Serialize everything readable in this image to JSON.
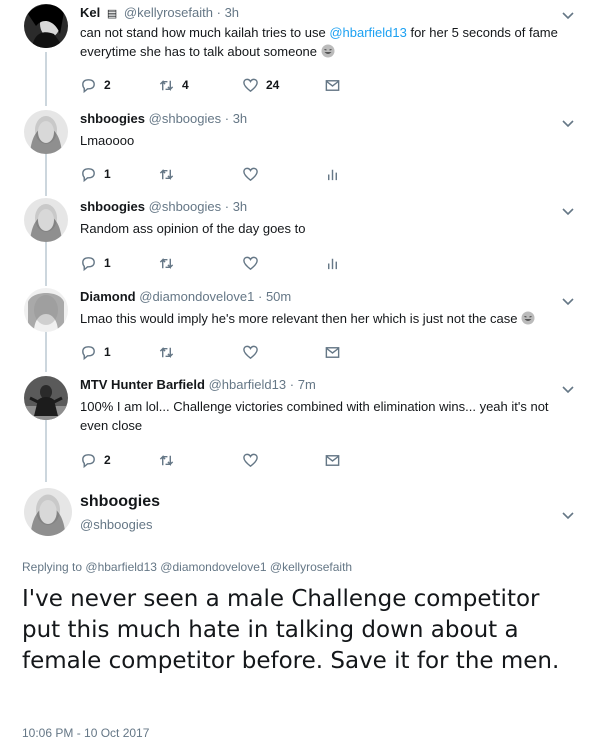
{
  "colors": {
    "link": "#1da1f2",
    "muted": "#657786",
    "thread": "#ccd6dd"
  },
  "tweets": [
    {
      "name": "Kel",
      "lock_icon": "lock-icon",
      "handle": "@kellyrosefaith",
      "sep": "·",
      "time": "3h",
      "text_before": "can not stand how much kailah tries to use ",
      "mention": "@hbarfield13",
      "text_after": " for her 5 seconds of fame everytime she has to talk about someone",
      "emoji": "laughing-emoji",
      "reply_count": "2",
      "retweet_count": "4",
      "like_count": "24",
      "last_action": "message-icon"
    },
    {
      "name": "shboogies",
      "handle": "@shboogies",
      "sep": "·",
      "time": "3h",
      "text": "Lmaoooo",
      "reply_count": "1",
      "retweet_count": "",
      "like_count": "",
      "last_action": "analytics-icon"
    },
    {
      "name": "shboogies",
      "handle": "@shboogies",
      "sep": "·",
      "time": "3h",
      "text": "Random ass opinion of the day goes to",
      "reply_count": "1",
      "retweet_count": "",
      "like_count": "",
      "last_action": "analytics-icon"
    },
    {
      "name": "Diamond",
      "handle": "@diamondovelove1",
      "sep": "·",
      "time": "50m",
      "text": "Lmao this would imply he's more relevant then her which is just not the case",
      "emoji": "laughing-emoji",
      "reply_count": "1",
      "retweet_count": "",
      "like_count": "",
      "last_action": "message-icon"
    },
    {
      "name": "MTV Hunter Barfield",
      "handle": "@hbarfield13",
      "sep": "·",
      "time": "7m",
      "text": "100% I am lol... Challenge victories combined with elimination wins... yeah it's not even close",
      "reply_count": "2",
      "retweet_count": "",
      "like_count": "",
      "last_action": "message-icon"
    }
  ],
  "main": {
    "name": "shboogies",
    "handle": "@shboogies",
    "replying_label": "Replying to",
    "replying_to": [
      "@hbarfield13",
      "@diamondovelove1",
      "@kellyrosefaith"
    ],
    "text": "I've never seen a male Challenge competitor put this much hate in talking down about a female competitor before. Save it for the men.",
    "timestamp": "10:06 PM - 10 Oct 2017"
  }
}
